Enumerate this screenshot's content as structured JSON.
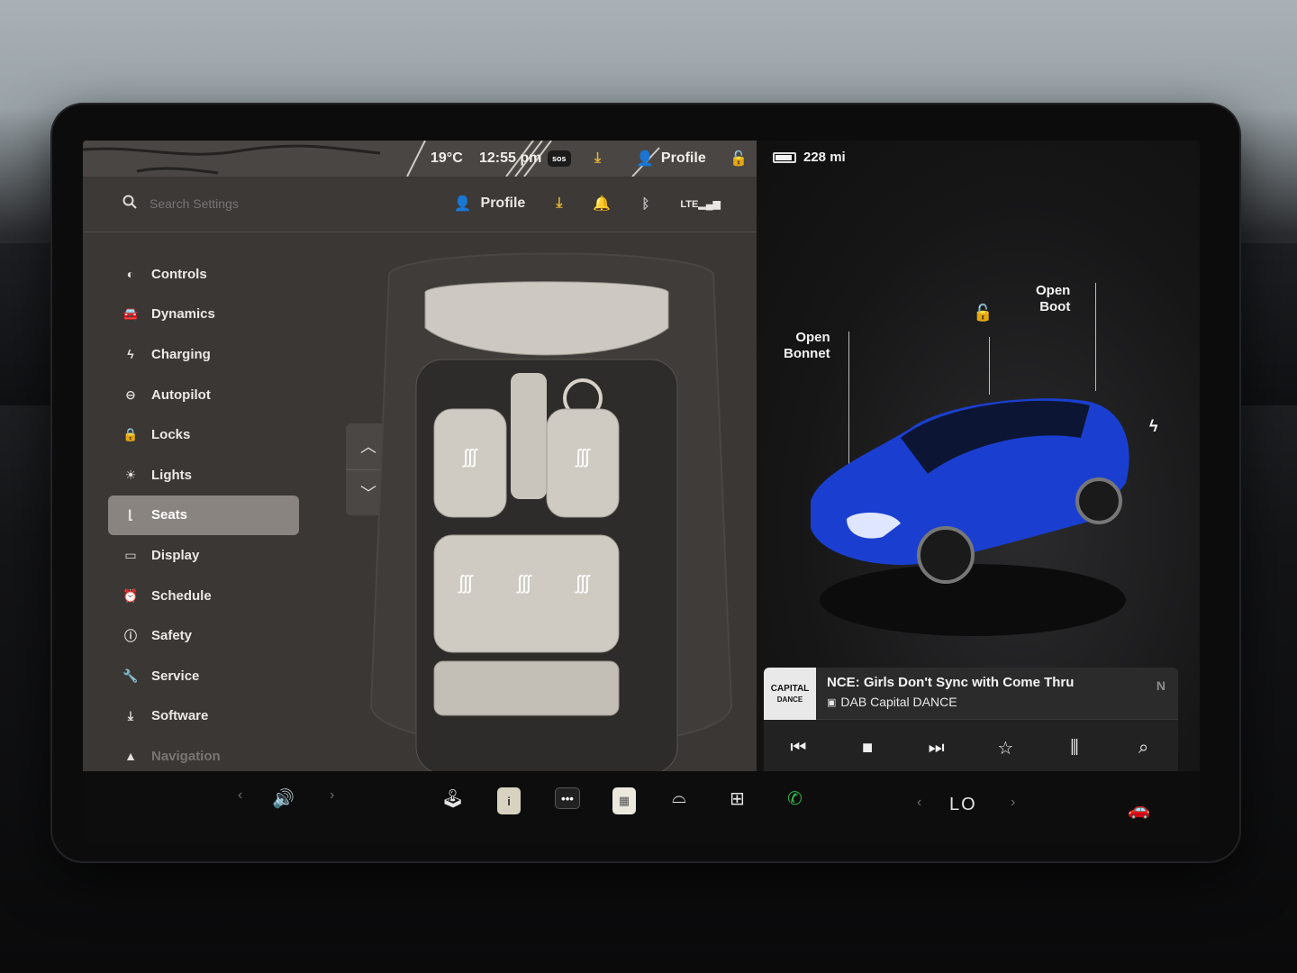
{
  "status_left": {
    "temperature": "19°C",
    "time": "12:55 pm",
    "sos": "sos",
    "profile": "Profile"
  },
  "status_right": {
    "range": "228 mi"
  },
  "settings": {
    "search_placeholder": "Search Settings",
    "profile": "Profile",
    "menu": [
      {
        "label": "Controls",
        "icon": "toggle-icon"
      },
      {
        "label": "Dynamics",
        "icon": "car-icon"
      },
      {
        "label": "Charging",
        "icon": "bolt-icon"
      },
      {
        "label": "Autopilot",
        "icon": "steering-wheel-icon"
      },
      {
        "label": "Locks",
        "icon": "lock-icon"
      },
      {
        "label": "Lights",
        "icon": "sun-icon"
      },
      {
        "label": "Seats",
        "icon": "seat-icon",
        "active": true
      },
      {
        "label": "Display",
        "icon": "display-icon"
      },
      {
        "label": "Schedule",
        "icon": "clock-icon"
      },
      {
        "label": "Safety",
        "icon": "info-icon"
      },
      {
        "label": "Service",
        "icon": "wrench-icon"
      },
      {
        "label": "Software",
        "icon": "download-icon"
      },
      {
        "label": "Navigation",
        "icon": "navigation-icon"
      }
    ],
    "menu_0": "Controls",
    "menu_1": "Dynamics",
    "menu_2": "Charging",
    "menu_3": "Autopilot",
    "menu_4": "Locks",
    "menu_5": "Lights",
    "menu_6": "Seats",
    "menu_7": "Display",
    "menu_8": "Schedule",
    "menu_9": "Safety",
    "menu_10": "Service",
    "menu_11": "Software",
    "menu_12": "Navigation"
  },
  "vehicle": {
    "open_bonnet_1": "Open",
    "open_bonnet_2": "Bonnet",
    "open_boot_1": "Open",
    "open_boot_2": "Boot",
    "car_color": "#1a3fd0"
  },
  "media": {
    "track": "NCE: Girls Don't Sync with Come Thru",
    "station": "DAB Capital DANCE",
    "next_hint": "N",
    "logo_text_1": "CAPITAL",
    "logo_text_2": "DANCE"
  },
  "dock": {
    "climate_temp": "LO"
  },
  "colors": {
    "accent_yellow": "#e6b43a",
    "call_green": "#2fbf4a",
    "active_menu": "#8a8480"
  }
}
